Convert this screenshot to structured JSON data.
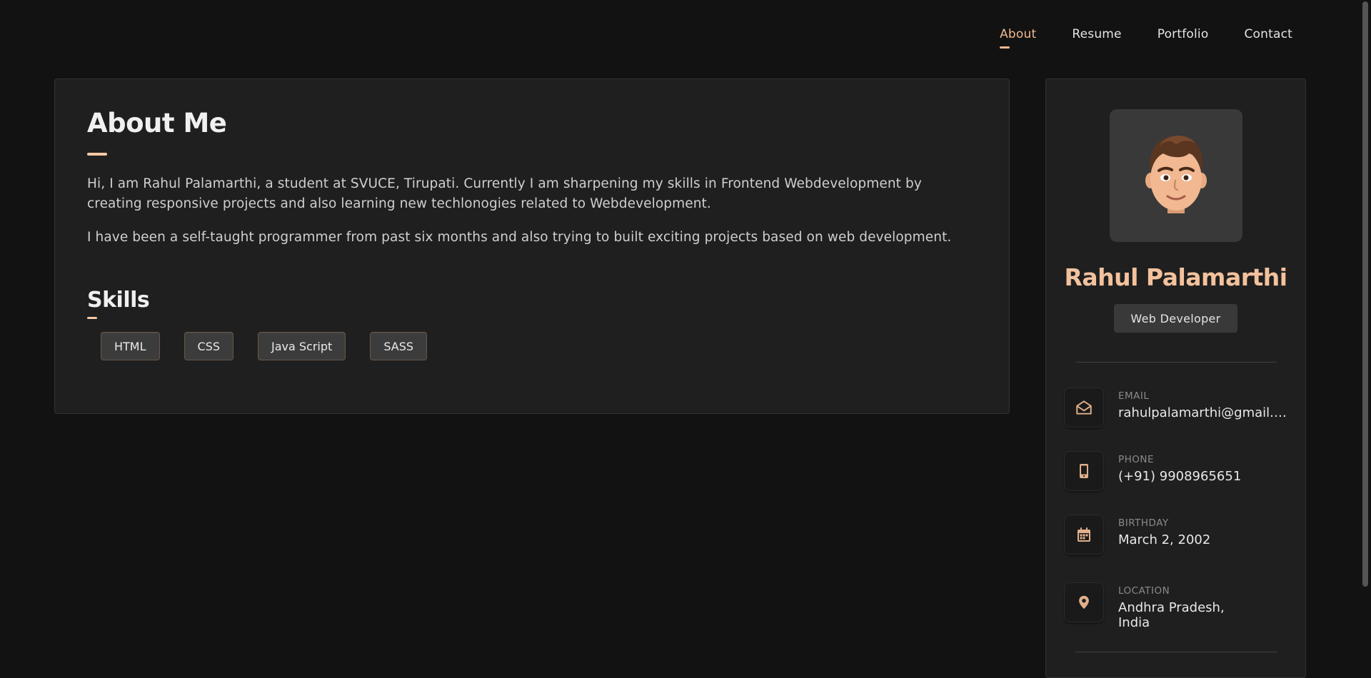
{
  "nav": {
    "items": [
      "About",
      "Resume",
      "Portfolio",
      "Contact"
    ],
    "active": "About"
  },
  "about": {
    "title": "About Me",
    "paragraph_1": "Hi, I am Rahul Palamarthi, a student at SVUCE, Tirupati. Currently I am sharpening my skills in Frontend Webdevelopment by creating responsive projects and also learning new techlonogies related to Webdevelopment.",
    "paragraph_2": "I have been a self-taught programmer from past six months and also trying to built exciting projects based on web development.",
    "skills_title": "Skills",
    "skills": [
      "HTML",
      "CSS",
      "Java Script",
      "SASS"
    ]
  },
  "profile": {
    "name": "Rahul Palamarthi",
    "role": "Web Developer",
    "contacts": [
      {
        "label": "EMAIL",
        "value": "rahulpalamarthi@gmail.com",
        "icon": "mail-open-icon"
      },
      {
        "label": "PHONE",
        "value": "(+91) 9908965651",
        "icon": "phone-icon"
      },
      {
        "label": "BIRTHDAY",
        "value": "March 2, 2002",
        "icon": "calendar-icon"
      },
      {
        "label": "LOCATION",
        "value": "Andhra Pradesh, India",
        "icon": "location-pin-icon"
      }
    ]
  },
  "colors": {
    "accent": "#f3c29d",
    "background": "#121212",
    "card": "#1f1f1f"
  }
}
